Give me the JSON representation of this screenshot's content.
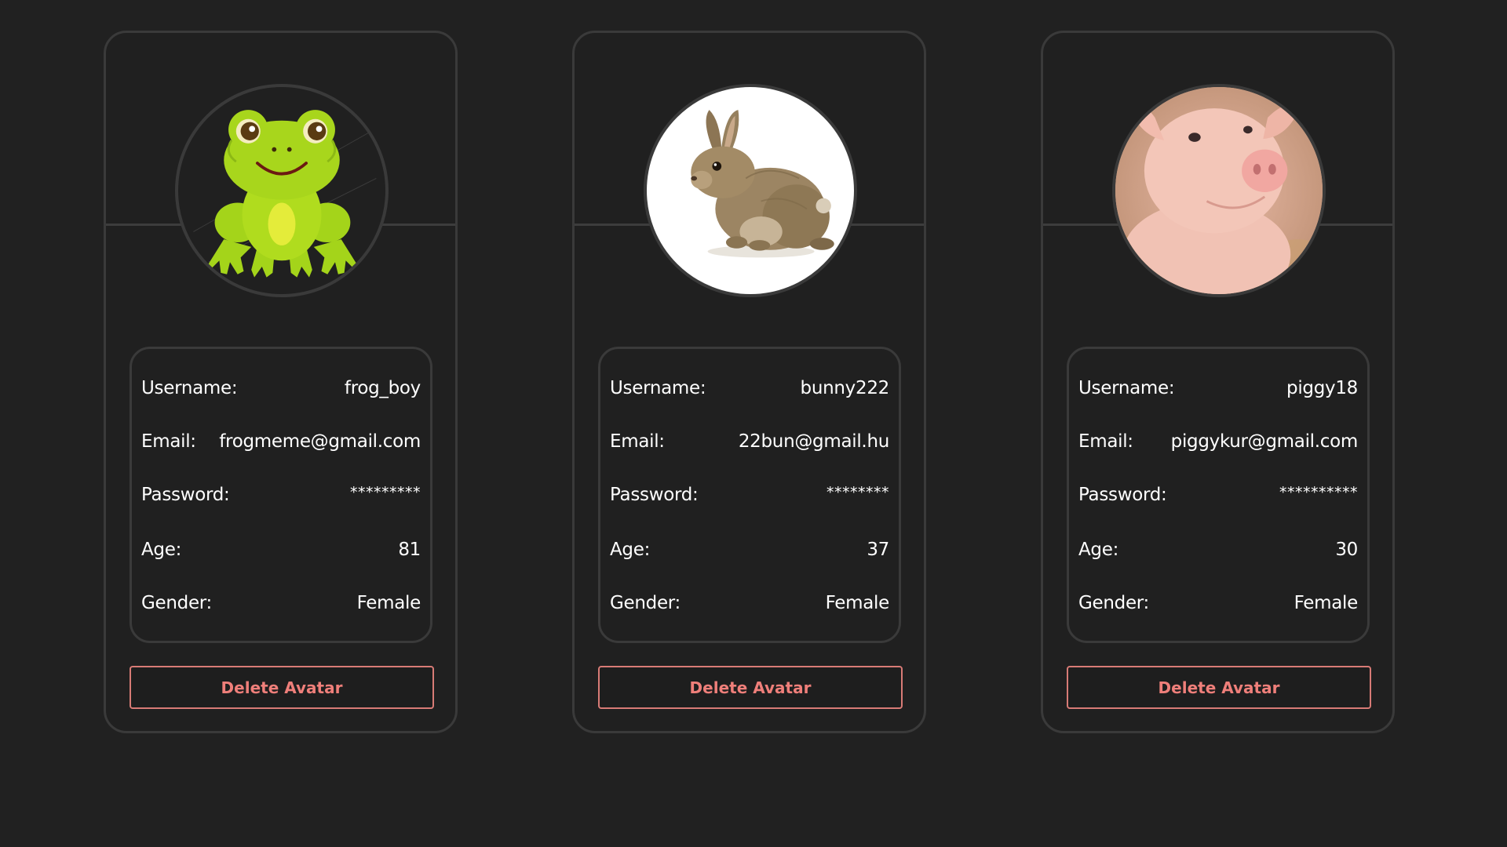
{
  "colors": {
    "background": "#212121",
    "card_border": "#3a3a3a",
    "danger": "#ef7f7a",
    "text": "#ffffff"
  },
  "labels": {
    "username": "Username:",
    "email": "Email:",
    "password": "Password:",
    "age": "Age:",
    "gender": "Gender:"
  },
  "users": [
    {
      "avatar_icon": "frog-avatar-icon",
      "username": "frog_boy",
      "email": "frogmeme@gmail.com",
      "password": "*********",
      "age": "81",
      "gender": "Female",
      "delete_label": "Delete Avatar"
    },
    {
      "avatar_icon": "bunny-avatar-icon",
      "username": "bunny222",
      "email": "22bun@gmail.hu",
      "password": "********",
      "age": "37",
      "gender": "Female",
      "delete_label": "Delete Avatar"
    },
    {
      "avatar_icon": "pig-avatar-icon",
      "username": "piggy18",
      "email": "piggykur@gmail.com",
      "password": "**********",
      "age": "30",
      "gender": "Female",
      "delete_label": "Delete Avatar"
    }
  ]
}
